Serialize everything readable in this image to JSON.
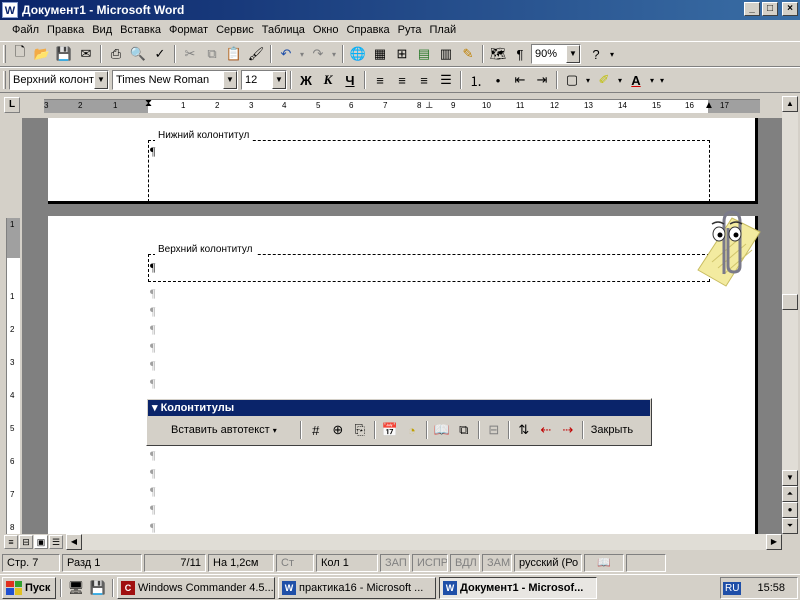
{
  "window": {
    "title": "Документ1 - Microsoft Word",
    "app_icon": "W"
  },
  "menu": [
    "Файл",
    "Правка",
    "Вид",
    "Вставка",
    "Формат",
    "Сервис",
    "Таблица",
    "Окно",
    "Справка",
    "Рута",
    "Плай"
  ],
  "standard_toolbar": {
    "zoom": "90%"
  },
  "format_toolbar": {
    "style": "Верхний колонт",
    "font": "Times New Roman",
    "size": "12",
    "bold": "Ж",
    "italic": "К",
    "underline": "Ч"
  },
  "ruler": {
    "ticks": [
      "3",
      "2",
      "1",
      "1",
      "2",
      "3",
      "4",
      "5",
      "6",
      "7",
      "8",
      "9",
      "10",
      "11",
      "12",
      "13",
      "14",
      "15",
      "16",
      "17"
    ],
    "corner": "L"
  },
  "vruler": {
    "ticks": [
      "1",
      "1",
      "2",
      "3",
      "4",
      "5",
      "6",
      "7",
      "8"
    ]
  },
  "document": {
    "footer_label": "Нижний колонтитул",
    "header_label": "Верхний колонтитул",
    "pilcrow": "¶"
  },
  "hf_toolbar": {
    "title": "Колонтитулы",
    "insert_autotext": "Вставить автотекст",
    "close": "Закрыть"
  },
  "status": {
    "page": "Стр. 7",
    "section": "Разд 1",
    "pages": "7/11",
    "at": "На 1,2см",
    "line": "Ст",
    "column": "Кол 1",
    "rec": "ЗАП",
    "trk": "ИСПР",
    "ext": "ВДЛ",
    "ovr": "ЗАМ",
    "lang": "русский (Ро"
  },
  "taskbar": {
    "start": "Пуск",
    "tasks": [
      "Windows Commander 4.5...",
      "практика16 - Microsoft ...",
      "Документ1 - Microsof..."
    ],
    "lang": "RU",
    "clock": "15:58"
  }
}
